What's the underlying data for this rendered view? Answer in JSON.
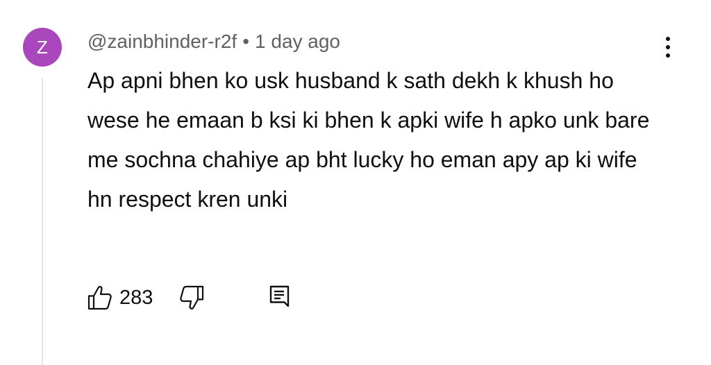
{
  "comment": {
    "avatar_letter": "Z",
    "avatar_color": "#ab47bc",
    "author": "@zainbhinder-r2f",
    "separator": "•",
    "timestamp": "1 day ago",
    "text": "Ap apni bhen ko usk husband k sath dekh k khush ho wese he emaan b ksi ki bhen k apki wife h apko unk bare me sochna chahiye ap bht lucky ho eman apy ap ki wife hn respect kren unki"
  },
  "actions": {
    "like_count": "283",
    "like_icon": "thumb-up-icon",
    "dislike_icon": "thumb-down-icon",
    "reply_icon": "reply-comment-icon",
    "menu_icon": "more-vertical-icon"
  }
}
